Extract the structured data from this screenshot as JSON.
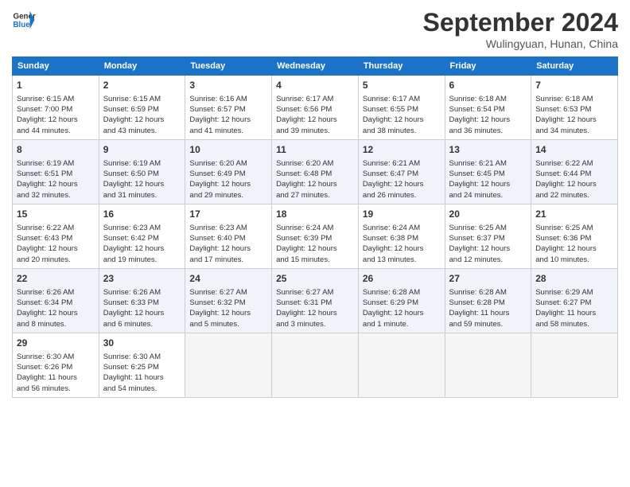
{
  "header": {
    "logo_line1": "General",
    "logo_line2": "Blue",
    "month": "September 2024",
    "location": "Wulingyuan, Hunan, China"
  },
  "days_of_week": [
    "Sunday",
    "Monday",
    "Tuesday",
    "Wednesday",
    "Thursday",
    "Friday",
    "Saturday"
  ],
  "weeks": [
    [
      {
        "day": 1,
        "lines": [
          "Sunrise: 6:15 AM",
          "Sunset: 7:00 PM",
          "Daylight: 12 hours",
          "and 44 minutes."
        ]
      },
      {
        "day": 2,
        "lines": [
          "Sunrise: 6:15 AM",
          "Sunset: 6:59 PM",
          "Daylight: 12 hours",
          "and 43 minutes."
        ]
      },
      {
        "day": 3,
        "lines": [
          "Sunrise: 6:16 AM",
          "Sunset: 6:57 PM",
          "Daylight: 12 hours",
          "and 41 minutes."
        ]
      },
      {
        "day": 4,
        "lines": [
          "Sunrise: 6:17 AM",
          "Sunset: 6:56 PM",
          "Daylight: 12 hours",
          "and 39 minutes."
        ]
      },
      {
        "day": 5,
        "lines": [
          "Sunrise: 6:17 AM",
          "Sunset: 6:55 PM",
          "Daylight: 12 hours",
          "and 38 minutes."
        ]
      },
      {
        "day": 6,
        "lines": [
          "Sunrise: 6:18 AM",
          "Sunset: 6:54 PM",
          "Daylight: 12 hours",
          "and 36 minutes."
        ]
      },
      {
        "day": 7,
        "lines": [
          "Sunrise: 6:18 AM",
          "Sunset: 6:53 PM",
          "Daylight: 12 hours",
          "and 34 minutes."
        ]
      }
    ],
    [
      {
        "day": 8,
        "lines": [
          "Sunrise: 6:19 AM",
          "Sunset: 6:51 PM",
          "Daylight: 12 hours",
          "and 32 minutes."
        ]
      },
      {
        "day": 9,
        "lines": [
          "Sunrise: 6:19 AM",
          "Sunset: 6:50 PM",
          "Daylight: 12 hours",
          "and 31 minutes."
        ]
      },
      {
        "day": 10,
        "lines": [
          "Sunrise: 6:20 AM",
          "Sunset: 6:49 PM",
          "Daylight: 12 hours",
          "and 29 minutes."
        ]
      },
      {
        "day": 11,
        "lines": [
          "Sunrise: 6:20 AM",
          "Sunset: 6:48 PM",
          "Daylight: 12 hours",
          "and 27 minutes."
        ]
      },
      {
        "day": 12,
        "lines": [
          "Sunrise: 6:21 AM",
          "Sunset: 6:47 PM",
          "Daylight: 12 hours",
          "and 26 minutes."
        ]
      },
      {
        "day": 13,
        "lines": [
          "Sunrise: 6:21 AM",
          "Sunset: 6:45 PM",
          "Daylight: 12 hours",
          "and 24 minutes."
        ]
      },
      {
        "day": 14,
        "lines": [
          "Sunrise: 6:22 AM",
          "Sunset: 6:44 PM",
          "Daylight: 12 hours",
          "and 22 minutes."
        ]
      }
    ],
    [
      {
        "day": 15,
        "lines": [
          "Sunrise: 6:22 AM",
          "Sunset: 6:43 PM",
          "Daylight: 12 hours",
          "and 20 minutes."
        ]
      },
      {
        "day": 16,
        "lines": [
          "Sunrise: 6:23 AM",
          "Sunset: 6:42 PM",
          "Daylight: 12 hours",
          "and 19 minutes."
        ]
      },
      {
        "day": 17,
        "lines": [
          "Sunrise: 6:23 AM",
          "Sunset: 6:40 PM",
          "Daylight: 12 hours",
          "and 17 minutes."
        ]
      },
      {
        "day": 18,
        "lines": [
          "Sunrise: 6:24 AM",
          "Sunset: 6:39 PM",
          "Daylight: 12 hours",
          "and 15 minutes."
        ]
      },
      {
        "day": 19,
        "lines": [
          "Sunrise: 6:24 AM",
          "Sunset: 6:38 PM",
          "Daylight: 12 hours",
          "and 13 minutes."
        ]
      },
      {
        "day": 20,
        "lines": [
          "Sunrise: 6:25 AM",
          "Sunset: 6:37 PM",
          "Daylight: 12 hours",
          "and 12 minutes."
        ]
      },
      {
        "day": 21,
        "lines": [
          "Sunrise: 6:25 AM",
          "Sunset: 6:36 PM",
          "Daylight: 12 hours",
          "and 10 minutes."
        ]
      }
    ],
    [
      {
        "day": 22,
        "lines": [
          "Sunrise: 6:26 AM",
          "Sunset: 6:34 PM",
          "Daylight: 12 hours",
          "and 8 minutes."
        ]
      },
      {
        "day": 23,
        "lines": [
          "Sunrise: 6:26 AM",
          "Sunset: 6:33 PM",
          "Daylight: 12 hours",
          "and 6 minutes."
        ]
      },
      {
        "day": 24,
        "lines": [
          "Sunrise: 6:27 AM",
          "Sunset: 6:32 PM",
          "Daylight: 12 hours",
          "and 5 minutes."
        ]
      },
      {
        "day": 25,
        "lines": [
          "Sunrise: 6:27 AM",
          "Sunset: 6:31 PM",
          "Daylight: 12 hours",
          "and 3 minutes."
        ]
      },
      {
        "day": 26,
        "lines": [
          "Sunrise: 6:28 AM",
          "Sunset: 6:29 PM",
          "Daylight: 12 hours",
          "and 1 minute."
        ]
      },
      {
        "day": 27,
        "lines": [
          "Sunrise: 6:28 AM",
          "Sunset: 6:28 PM",
          "Daylight: 11 hours",
          "and 59 minutes."
        ]
      },
      {
        "day": 28,
        "lines": [
          "Sunrise: 6:29 AM",
          "Sunset: 6:27 PM",
          "Daylight: 11 hours",
          "and 58 minutes."
        ]
      }
    ],
    [
      {
        "day": 29,
        "lines": [
          "Sunrise: 6:30 AM",
          "Sunset: 6:26 PM",
          "Daylight: 11 hours",
          "and 56 minutes."
        ]
      },
      {
        "day": 30,
        "lines": [
          "Sunrise: 6:30 AM",
          "Sunset: 6:25 PM",
          "Daylight: 11 hours",
          "and 54 minutes."
        ]
      },
      null,
      null,
      null,
      null,
      null
    ]
  ]
}
